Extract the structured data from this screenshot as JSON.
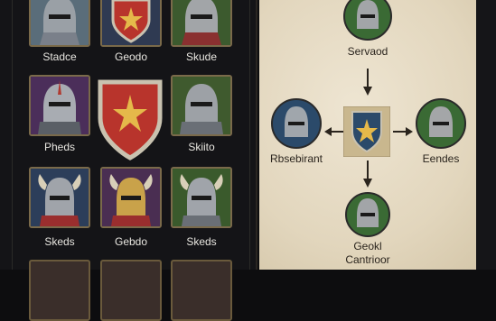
{
  "left_grid": {
    "slots": [
      {
        "label": "Stadce",
        "bg": "#5a6d7a",
        "icon": "knight-helmet-icon"
      },
      {
        "label": "Geodo",
        "bg": "#2f3a52",
        "icon": "shield-star-icon"
      },
      {
        "label": "Skude",
        "bg": "#3c5a2e",
        "icon": "knight-helmet-icon"
      },
      {
        "label": "Pheds",
        "bg": "#4b2e5a",
        "icon": "knight-helmet-icon"
      },
      {
        "label": "",
        "bg": "#2c2c2e",
        "icon": "shield-star-icon"
      },
      {
        "label": "Skiito",
        "bg": "#3f5a2e",
        "icon": "knight-helmet-icon"
      },
      {
        "label": "Skeds",
        "bg": "#2c3e5a",
        "icon": "horned-helmet-icon"
      },
      {
        "label": "Gebdo",
        "bg": "#4a2e52",
        "icon": "horned-helmet-icon"
      },
      {
        "label": "Skeds",
        "bg": "#3a5a2c",
        "icon": "horned-helmet-icon"
      }
    ]
  },
  "tree": {
    "top": {
      "label": "Servaod",
      "bg": "#3a6a34"
    },
    "left": {
      "label": "Rbsebirant",
      "bg": "#2b4a6a"
    },
    "center": {
      "label": "",
      "bg": "#c9b78e"
    },
    "right": {
      "label": "Eendes",
      "bg": "#3a6a34"
    },
    "bottom": {
      "label_line1": "Geokl",
      "label_line2": "Cantrioor",
      "bg": "#3a6a34"
    }
  },
  "colors": {
    "frame_gold": "#7a6a4a",
    "parchment": "#e4d9c3",
    "dark_bg": "#141417"
  }
}
